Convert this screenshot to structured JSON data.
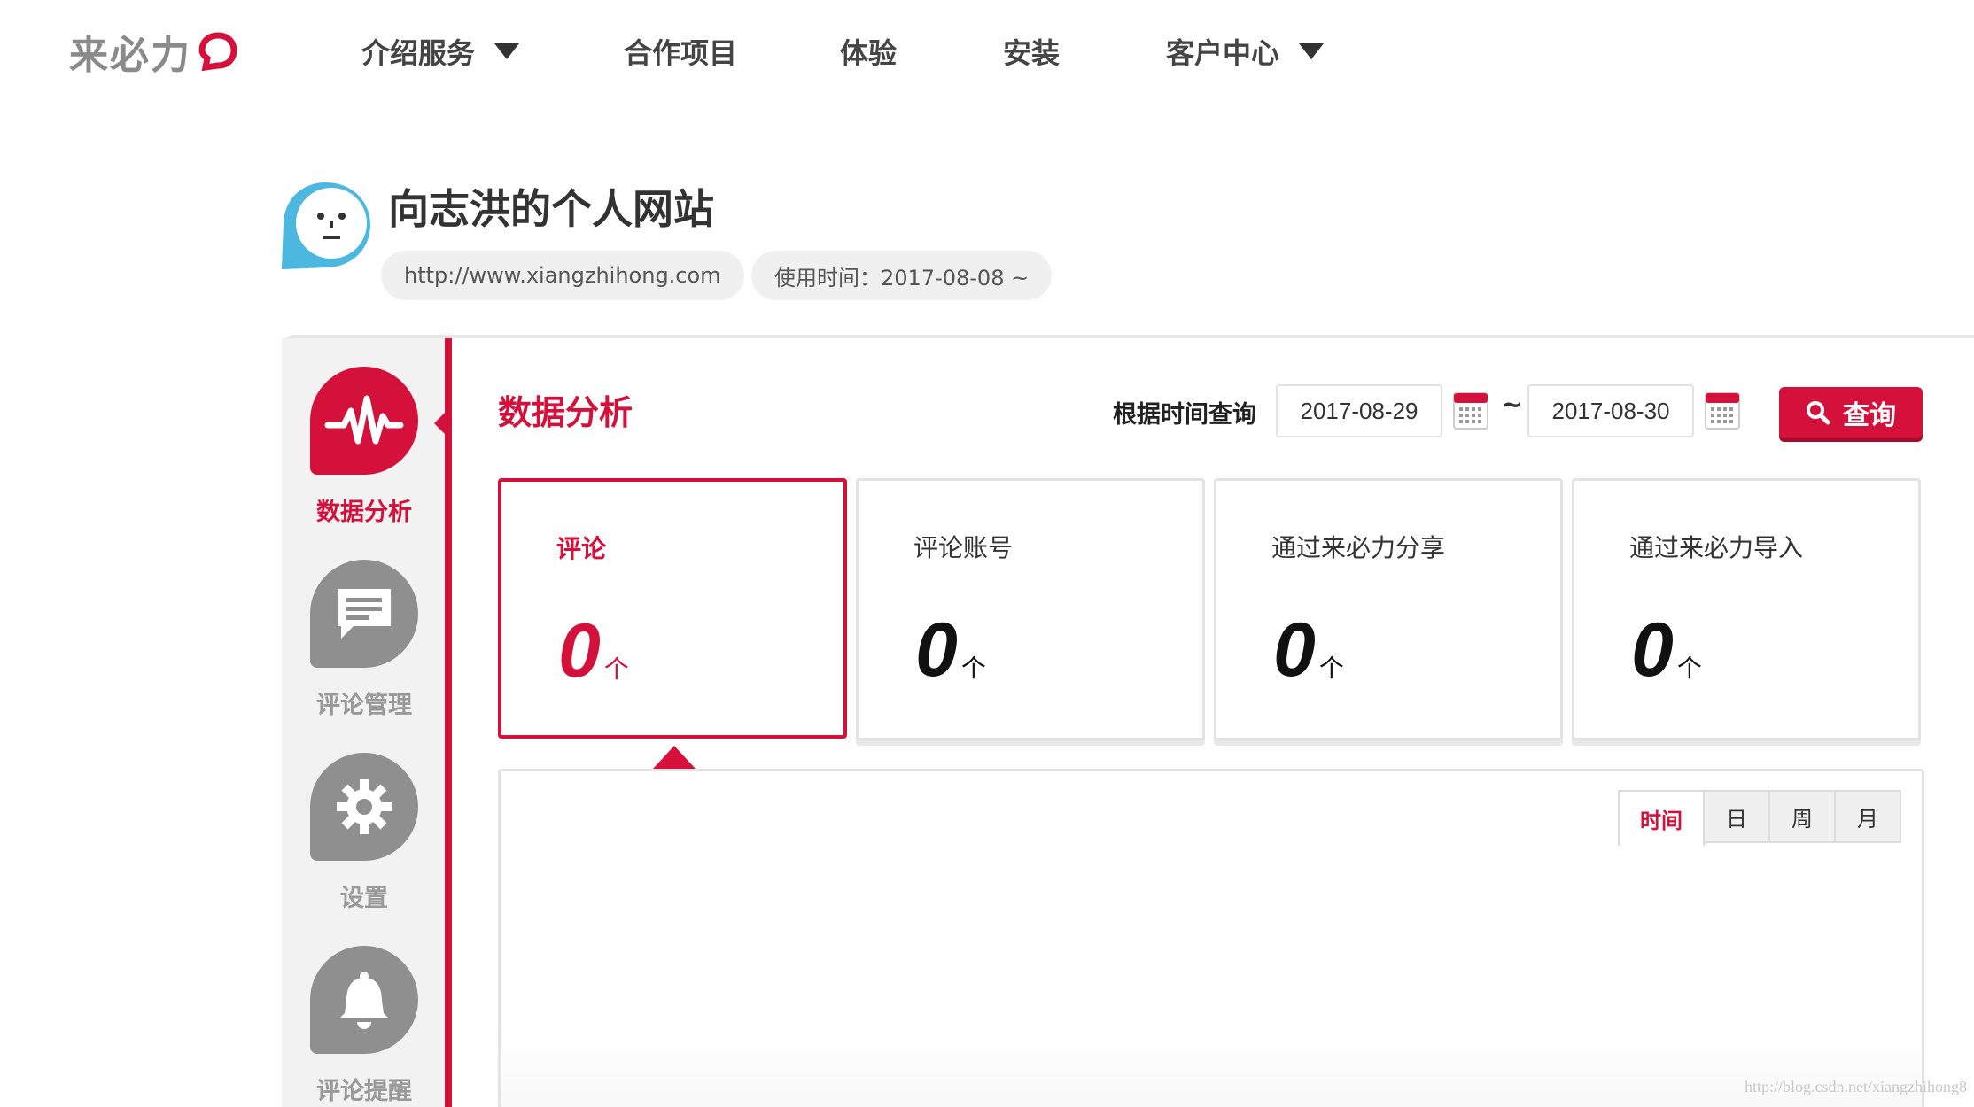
{
  "brand": {
    "name": "来必力",
    "accent": "#d3113b"
  },
  "nav": {
    "items": [
      {
        "label": "介绍服务",
        "has_dropdown": true
      },
      {
        "label": "合作项目",
        "has_dropdown": false
      },
      {
        "label": "体验",
        "has_dropdown": false
      },
      {
        "label": "安装",
        "has_dropdown": false
      },
      {
        "label": "客户中心",
        "has_dropdown": true
      }
    ]
  },
  "site": {
    "title": "向志洪的个人网站",
    "url": "http://www.xiangzhihong.com",
    "usage_time": "使用时间：2017-08-08 ~"
  },
  "sidebar": {
    "items": [
      {
        "label": "数据分析",
        "icon": "pulse-icon",
        "active": true
      },
      {
        "label": "评论管理",
        "icon": "comment-icon",
        "active": false
      },
      {
        "label": "设置",
        "icon": "gear-icon",
        "active": false
      },
      {
        "label": "评论提醒",
        "icon": "bell-icon",
        "active": false
      }
    ]
  },
  "main": {
    "title": "数据分析",
    "query": {
      "label": "根据时间查询",
      "start_date": "2017-08-29",
      "separator": "~",
      "end_date": "2017-08-30",
      "search_label": "查询"
    },
    "stats": [
      {
        "label": "评论",
        "value": "0",
        "unit": "个",
        "active": true
      },
      {
        "label": "评论账号",
        "value": "0",
        "unit": "个",
        "active": false
      },
      {
        "label": "通过来必力分享",
        "value": "0",
        "unit": "个",
        "active": false
      },
      {
        "label": "通过来必力导入",
        "value": "0",
        "unit": "个",
        "active": false
      }
    ],
    "period_tabs": [
      {
        "label": "时间",
        "active": true
      },
      {
        "label": "日",
        "active": false
      },
      {
        "label": "周",
        "active": false
      },
      {
        "label": "月",
        "active": false
      }
    ]
  },
  "watermark": "http://blog.csdn.net/xiangzhihong8"
}
